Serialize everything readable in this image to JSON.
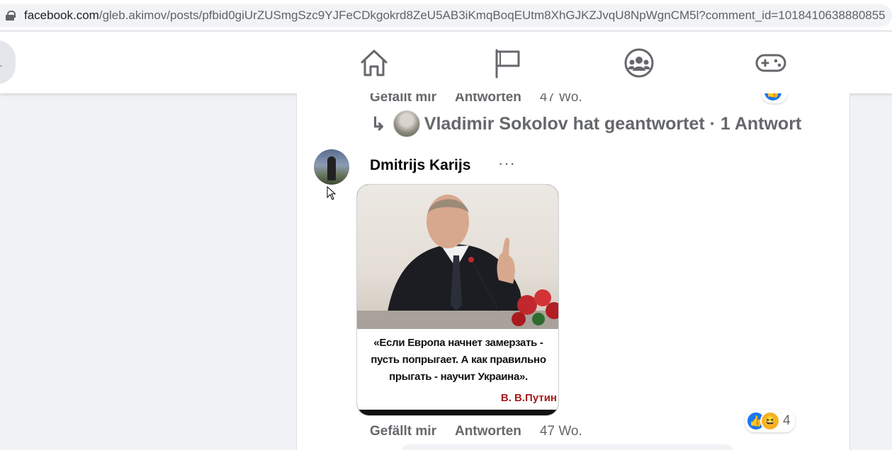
{
  "browser": {
    "url_host": "facebook.com",
    "url_path": "/gleb.akimov/posts/pfbid0giUrZUSmgSzc9YJFeCDkgokrd8ZeU5AB3iKmqBoqEUtm8XhGJKZJvqU8NpWgnCM5l?comment_id=1018410638880855"
  },
  "nav": {
    "back_label": ".",
    "icons": [
      "home-icon",
      "flag-icon",
      "groups-icon",
      "gaming-icon"
    ]
  },
  "prev_comment": {
    "like_label": "Gefällt mir",
    "reply_label": "Antworten",
    "time": "47 Wo.",
    "replies_text": "Vladimir Sokolov hat geantwortet · 1 Antwort"
  },
  "comment": {
    "author": "Dmitrijs Karijs",
    "more_label": "···",
    "meme": {
      "quote_line1": "«Если Европа начнет замерзать -",
      "quote_line2": "пусть попрыгает. А как правильно",
      "quote_line3": "прыгать - научит Украина».",
      "author": "В. В.Путин"
    },
    "like_label": "Gefällt mir",
    "reply_label": "Antworten",
    "time": "47 Wo.",
    "reaction_count": "4"
  },
  "colors": {
    "like_blue": "#1877f2",
    "haha_yellow": "#f7b125",
    "secondary_text": "#65676b"
  }
}
